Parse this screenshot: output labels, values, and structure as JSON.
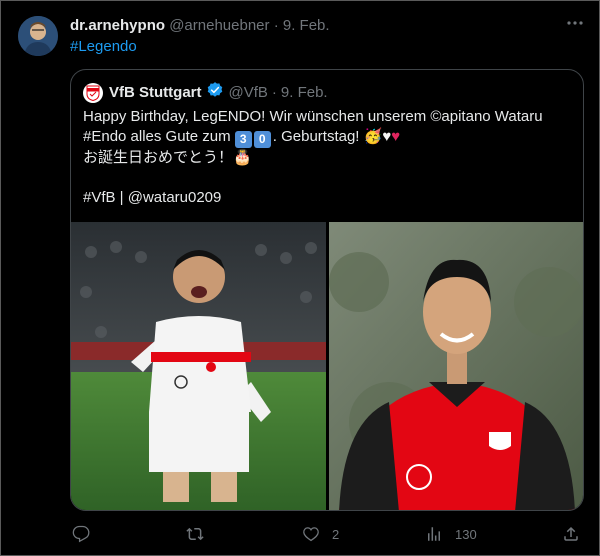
{
  "tweet": {
    "author_name": "dr.arnehypno",
    "author_handle": "@arnehuebner",
    "separator": "·",
    "date": "9. Feb.",
    "text": "#Legendo"
  },
  "quoted": {
    "author_name": "VfB Stuttgart",
    "author_handle": "@VfB",
    "separator": "·",
    "date": "9. Feb.",
    "line1": "Happy Birthday, LegENDO! Wir wünschen unserem ©apitano Wataru",
    "line2_start": "#Endo alles Gute zum",
    "digit1": "3",
    "digit2": "0",
    "line2_end": ". Geburtstag!",
    "line3": "お誕生日おめでとう！",
    "line5": "#VfB | @wataru0209",
    "emoji_party": "🥳",
    "emoji_white_heart": "♥",
    "emoji_red_heart": "♥",
    "emoji_cake": "🎂"
  },
  "actions": {
    "reply_count": "",
    "retweet_count": "",
    "like_count": "2",
    "views_count": "130"
  },
  "colors": {
    "link": "#1d9bf0",
    "muted": "#71767b",
    "text": "#e7e9ea",
    "verified": "#1d9bf0"
  },
  "icons": [
    "more-icon",
    "verified-badge-icon",
    "reply-icon",
    "retweet-icon",
    "like-icon",
    "views-icon",
    "share-icon"
  ]
}
